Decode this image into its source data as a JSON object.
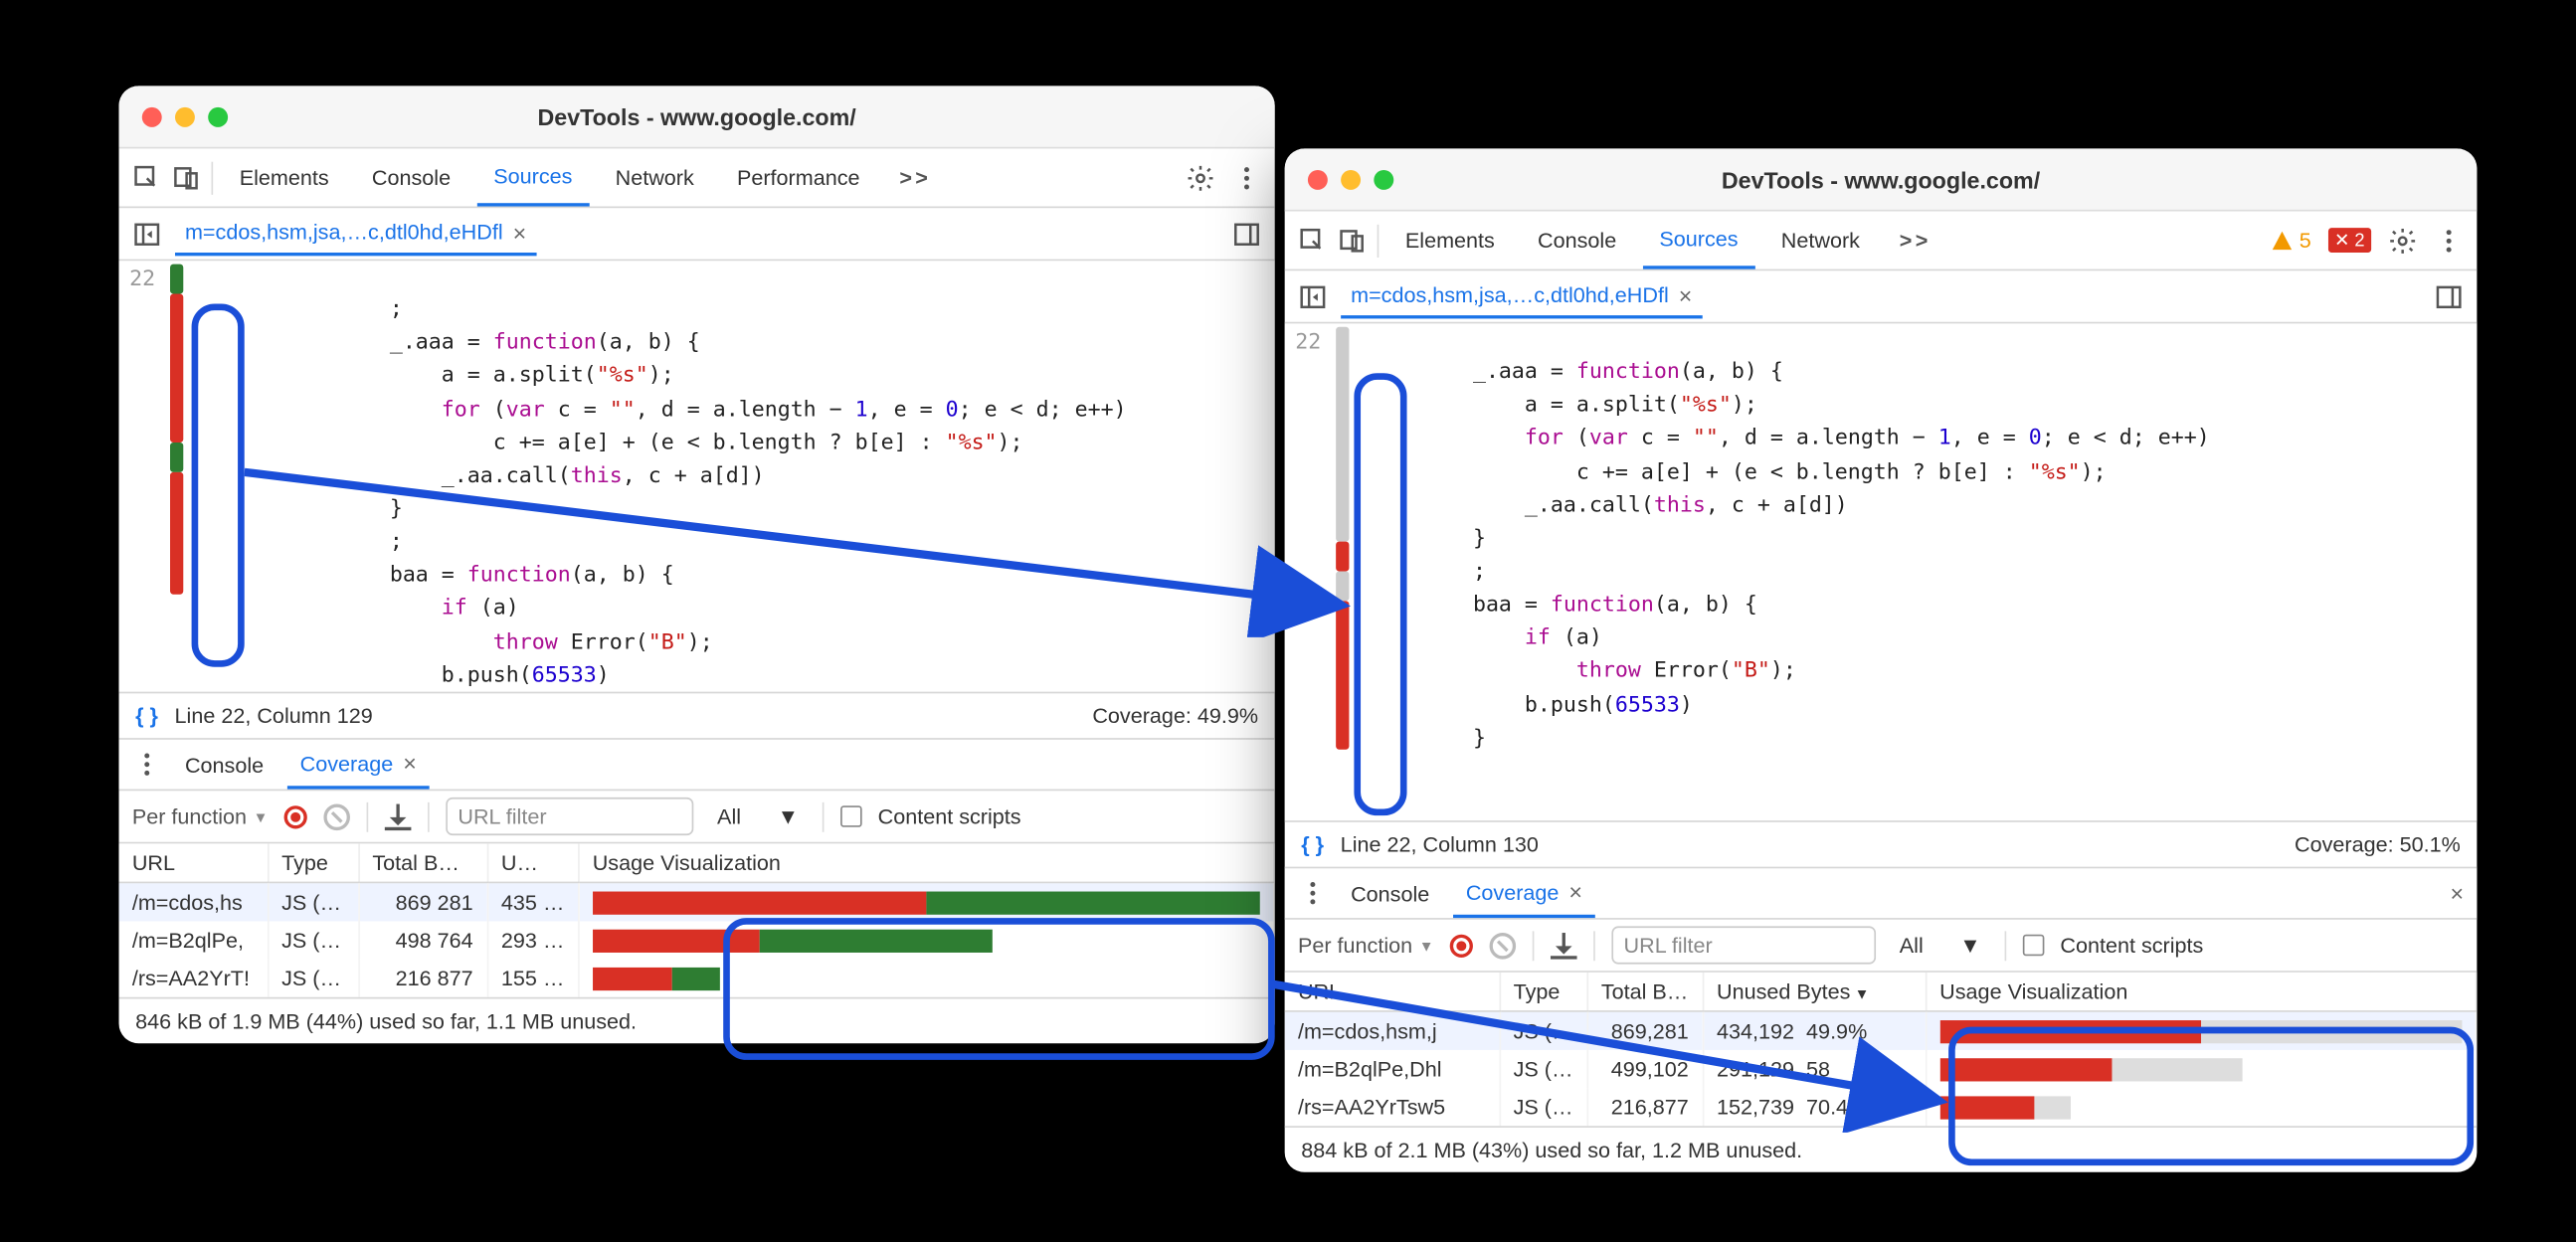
{
  "window1": {
    "title": "DevTools - www.google.com/",
    "tabs": {
      "elements": "Elements",
      "console": "Console",
      "sources": "Sources",
      "network": "Network",
      "performance": "Performance",
      "more": ">>"
    },
    "source_tab": "m=cdos,hsm,jsa,…c,dtl0hd,eHDfl",
    "line_num": "22",
    "status_line": "Line 22, Column 129",
    "status_cov": "Coverage: 49.9%",
    "drawer": {
      "console": "Console",
      "coverage": "Coverage"
    },
    "cov_toolbar": {
      "perfn": "Per function",
      "url_ph": "URL filter",
      "all": "All",
      "content": "Content scripts"
    },
    "cov_head": {
      "url": "URL",
      "type": "Type",
      "total": "Total B…",
      "unused": "U…",
      "usage": "Usage Visualization"
    },
    "rows": [
      {
        "url": "/m=cdos,hs",
        "type": "JS (…",
        "total": "869 281",
        "unused": "435 …",
        "red": 50,
        "green": 50,
        "grey": 0
      },
      {
        "url": "/m=B2qlPe,",
        "type": "JS (…",
        "total": "498 764",
        "unused": "293 …",
        "red": 25,
        "green": 35,
        "grey": 0
      },
      {
        "url": "/rs=AA2YrT!",
        "type": "JS (…",
        "total": "216 877",
        "unused": "155 …",
        "red": 12,
        "green": 7,
        "grey": 0
      }
    ],
    "summary": "846 kB of 1.9 MB (44%) used so far, 1.1 MB unused."
  },
  "window2": {
    "title": "DevTools - www.google.com/",
    "tabs": {
      "elements": "Elements",
      "console": "Console",
      "sources": "Sources",
      "network": "Network",
      "more": ">>"
    },
    "badge_w": "5",
    "badge_e": "2",
    "source_tab": "m=cdos,hsm,jsa,…c,dtl0hd,eHDfl",
    "line_num": "22",
    "status_line": "Line 22, Column 130",
    "status_cov": "Coverage: 50.1%",
    "drawer": {
      "console": "Console",
      "coverage": "Coverage"
    },
    "cov_toolbar": {
      "perfn": "Per function",
      "url_ph": "URL filter",
      "all": "All",
      "content": "Content scripts"
    },
    "cov_head": {
      "url": "URL",
      "type": "Type",
      "total": "Total B…",
      "unused": "Unused Bytes",
      "usage": "Usage Visualization"
    },
    "rows": [
      {
        "url": "/m=cdos,hsm,j",
        "type": "JS (…",
        "total": "869,281",
        "unused": "434,192",
        "pct": "49.9%",
        "red": 50,
        "grey": 50
      },
      {
        "url": "/m=B2qlPe,Dhl",
        "type": "JS (…",
        "total": "499,102",
        "unused": "291,129",
        "pct": "58",
        "red": 33,
        "grey": 25
      },
      {
        "url": "/rs=AA2YrTsw5",
        "type": "JS (…",
        "total": "216,877",
        "unused": "152,739",
        "pct": "70.4%",
        "red": 18,
        "grey": 7
      }
    ],
    "summary": "884 kB of 2.1 MB (43%) used so far, 1.2 MB unused."
  },
  "code": {
    "l1": ";",
    "l2a": "_.aaa = ",
    "l2b": "function",
    "l2c": "(a, b) {",
    "l3a": "    a = a.split(",
    "l3b": "\"%s\"",
    "l3c": ");",
    "l4a": "    ",
    "l4b": "for",
    "l4c": " (",
    "l4d": "var",
    "l4e": " c = ",
    "l4f": "\"\"",
    "l4g": ", d = a.length − ",
    "l4h": "1",
    "l4i": ", e = ",
    "l4j": "0",
    "l4k": "; e < d; e++)",
    "l5a": "        c += a[e] + (e < b.length ? b[e] : ",
    "l5b": "\"%s\"",
    "l5c": ");",
    "l6a": "    _.aa.call(",
    "l6b": "this",
    "l6c": ", c + a[d])",
    "l7": "}",
    "l8": ";",
    "l9a": "baa = ",
    "l9b": "function",
    "l9c": "(a, b) {",
    "l10a": "    ",
    "l10b": "if",
    "l10c": " (a)",
    "l11a": "        ",
    "l11b": "throw",
    "l11c": " Error(",
    "l11d": "\"B\"",
    "l11e": ");",
    "l12a": "    b.push(",
    "l12b": "65533",
    "l12c": ")",
    "l13": "}"
  }
}
